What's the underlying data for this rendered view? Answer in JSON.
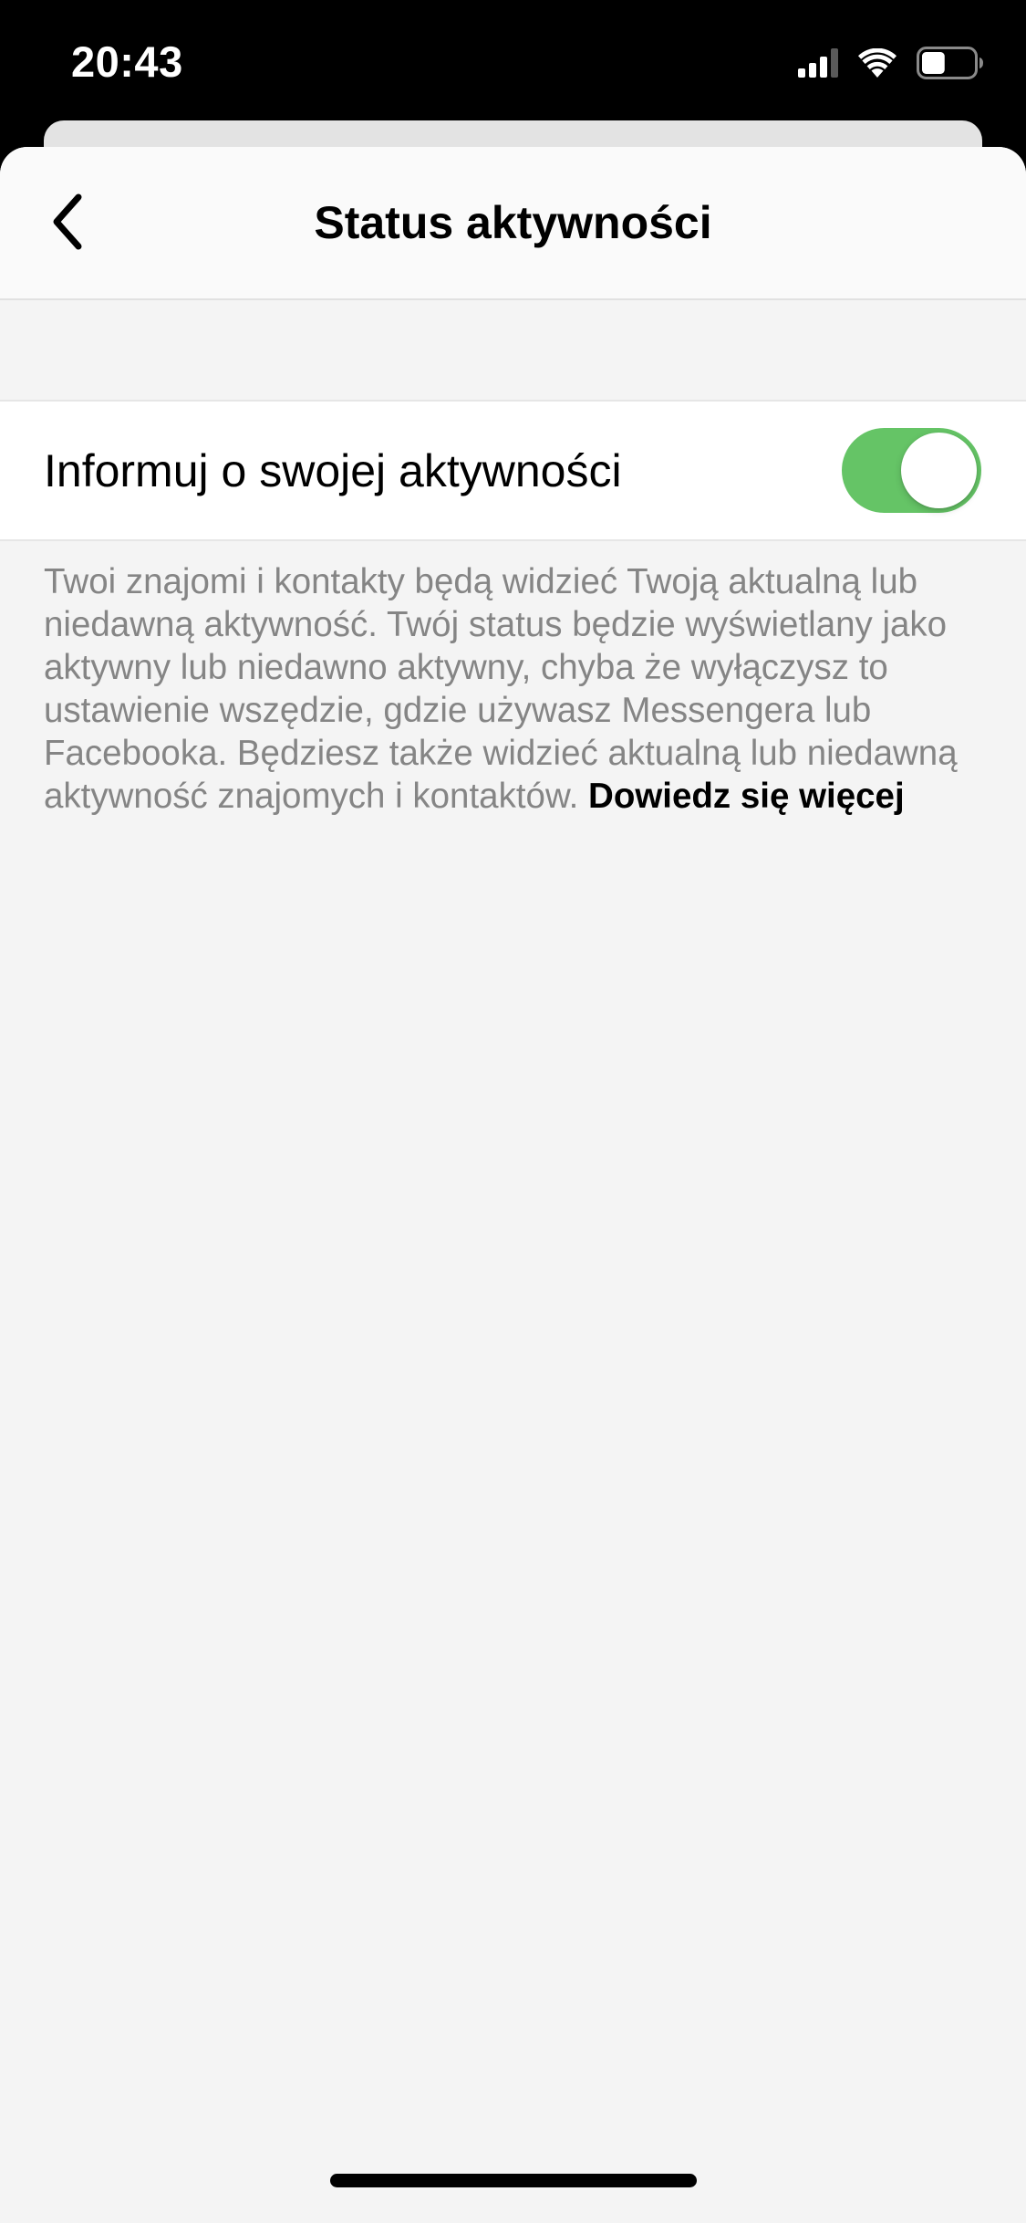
{
  "status_bar": {
    "time": "20:43",
    "icons": [
      "cellular-signal-icon",
      "wifi-icon",
      "battery-icon"
    ],
    "battery_level": 0.45
  },
  "nav": {
    "back_icon": "chevron-left-icon",
    "title": "Status aktywności"
  },
  "setting": {
    "label": "Informuj o swojej aktywności",
    "toggle_on": true,
    "toggle_color": "#65c466"
  },
  "description": {
    "text": "Twoi znajomi i kontakty będą widzieć Twoją aktualną lub niedawną aktywność. Twój status będzie wyświetlany jako aktywny lub niedawno aktywny, chyba że wyłączysz to ustawienie wszędzie, gdzie używasz Messengera lub Facebooka. Będziesz także widzieć aktualną lub niedawną aktywność znajomych i kontaktów. ",
    "link": "Dowiedz się więcej"
  },
  "colors": {
    "background": "#f4f4f4",
    "nav_background": "#fafafa",
    "secondary_text": "#858585"
  }
}
